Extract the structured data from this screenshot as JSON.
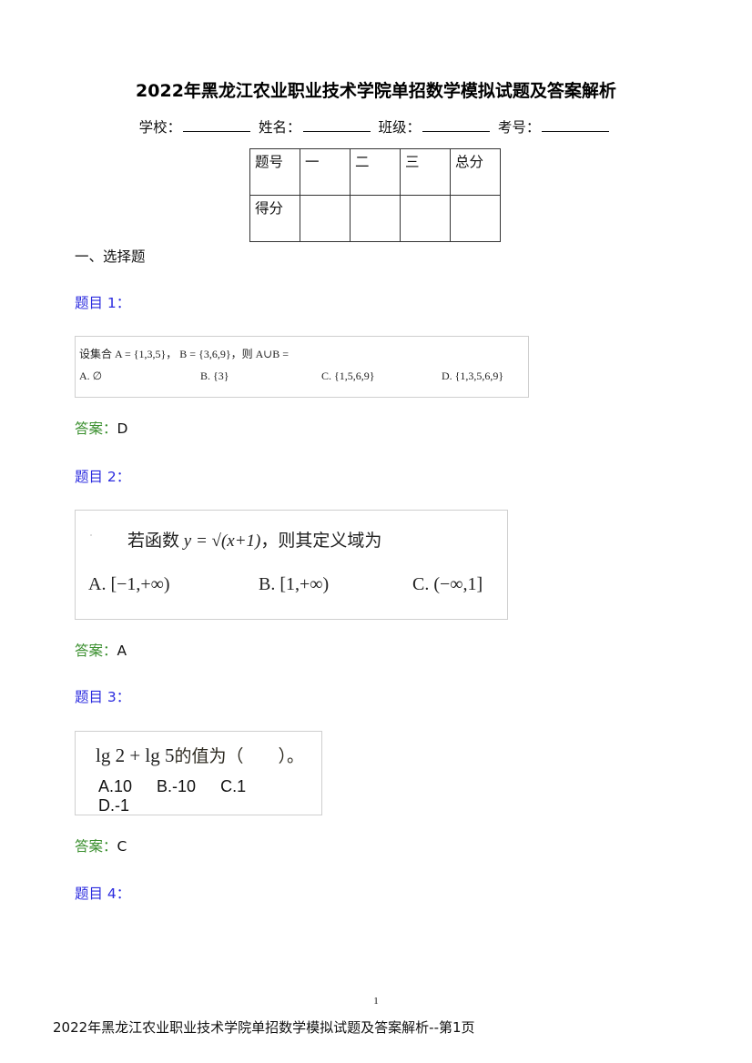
{
  "document": {
    "title": "2022年黑龙江农业职业技术学院单招数学模拟试题及答案解析",
    "info_fields": [
      {
        "label": "学校："
      },
      {
        "label": "姓名："
      },
      {
        "label": "班级："
      },
      {
        "label": "考号："
      }
    ],
    "score_table": {
      "header": [
        "题号",
        "一",
        "二",
        "三",
        "总分"
      ],
      "row": [
        "得分",
        "",
        "",
        "",
        ""
      ]
    },
    "section_title": "一、选择题",
    "questions": [
      {
        "label": "题目 1：",
        "stem": "设集合 A = {1,3,5}， B = {3,6,9}，则 A∪B =",
        "options": [
          "A.  ∅",
          "B.  {3}",
          "C.  {1,5,6,9}",
          "D.  {1,3,5,6,9}"
        ],
        "answer_key": "答案：",
        "answer": "D"
      },
      {
        "label": "题目 2：",
        "stem_prefix": "若函数 ",
        "stem_math": "y = √(x+1)",
        "stem_suffix": "，则其定义域为",
        "options": [
          "A.  [−1,+∞)",
          "B.  [1,+∞)",
          "C.  (−∞,1]"
        ],
        "answer_key": "答案：",
        "answer": "A"
      },
      {
        "label": "题目 3：",
        "stem_math": "lg 2 + lg 5",
        "stem_suffix": "的值为（　　）。",
        "options": [
          "A.10",
          "B.-10",
          "C.1",
          "D.-1"
        ],
        "answer_key": "答案：",
        "answer": "C"
      },
      {
        "label": "题目 4："
      }
    ],
    "page_number": "1",
    "footer": "2022年黑龙江农业职业技术学院单招数学模拟试题及答案解析--第1页"
  },
  "colors": {
    "question_label": "#2b2bdf",
    "answer_key": "#3a8f2e"
  }
}
